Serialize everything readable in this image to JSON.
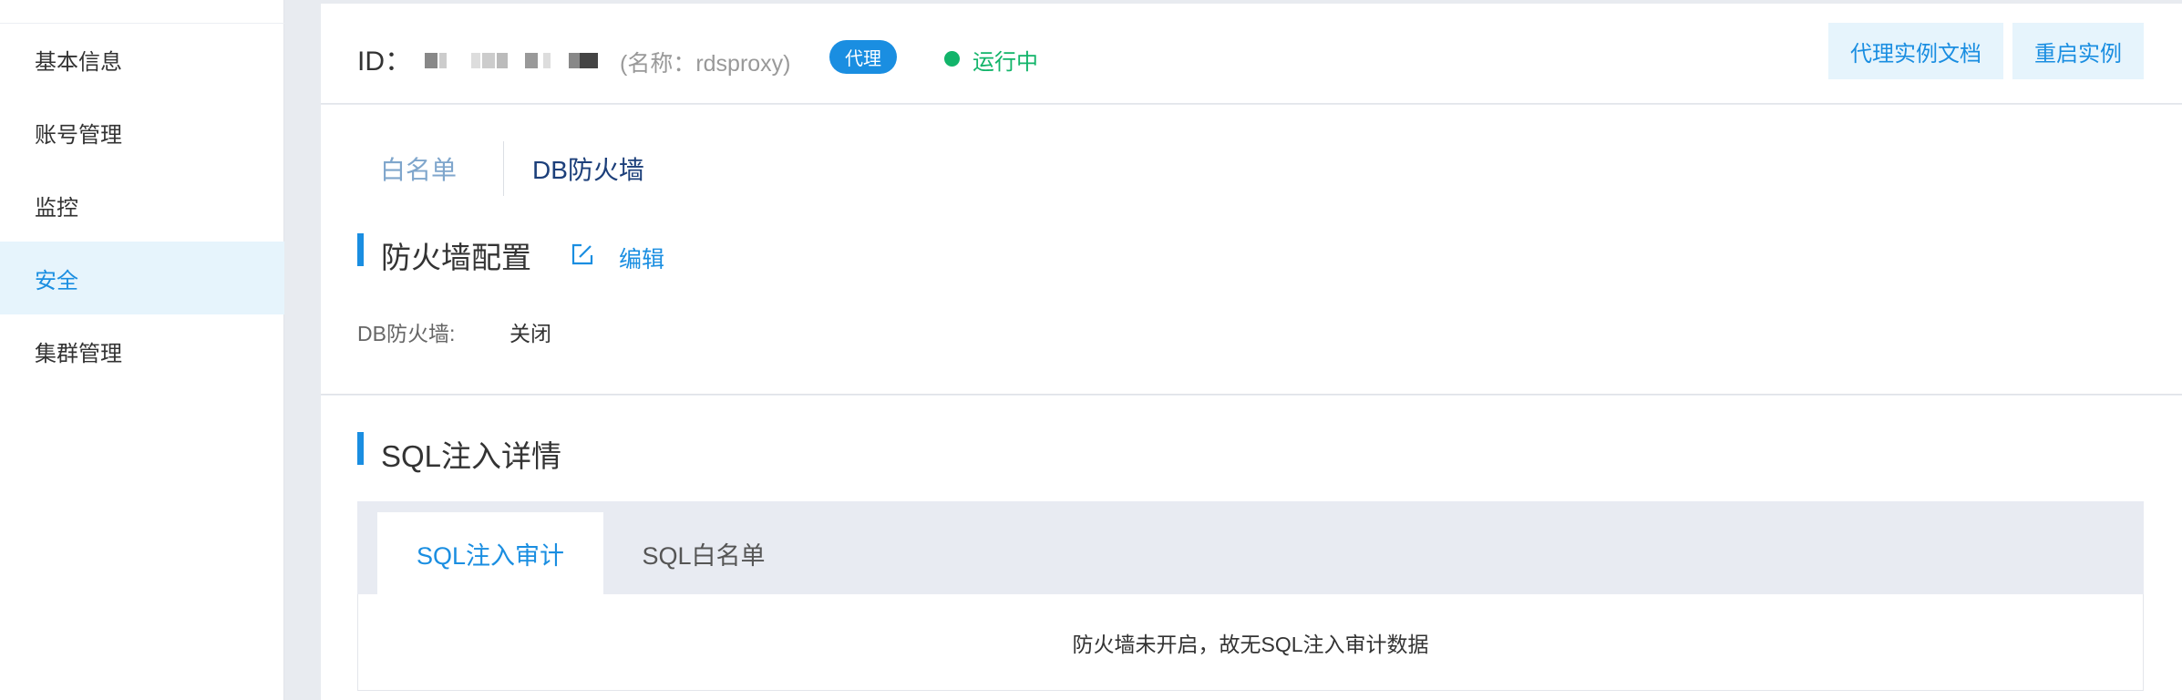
{
  "sidebar": {
    "items": [
      {
        "label": "基本信息"
      },
      {
        "label": "账号管理"
      },
      {
        "label": "监控"
      },
      {
        "label": "安全",
        "active": true
      },
      {
        "label": "集群管理"
      }
    ]
  },
  "header": {
    "id_label": "ID：",
    "instance_name": "(名称：rdsproxy)",
    "badge": "代理",
    "status": "运行中",
    "buttons": {
      "doc": "代理实例文档",
      "restart": "重启实例"
    }
  },
  "tabs": {
    "whitelist": "白名单",
    "firewall": "DB防火墙"
  },
  "firewall_config": {
    "title": "防火墙配置",
    "edit": "编辑",
    "field_label": "DB防火墙:",
    "field_value": "关闭"
  },
  "sql_injection": {
    "title": "SQL注入详情",
    "tabs": [
      "SQL注入审计",
      "SQL白名单"
    ],
    "empty_message": "防火墙未开启，故无SQL注入审计数据"
  },
  "colors": {
    "accent": "#1a8ee1",
    "running": "#12b46a",
    "active_bg": "#e6f4fc"
  }
}
